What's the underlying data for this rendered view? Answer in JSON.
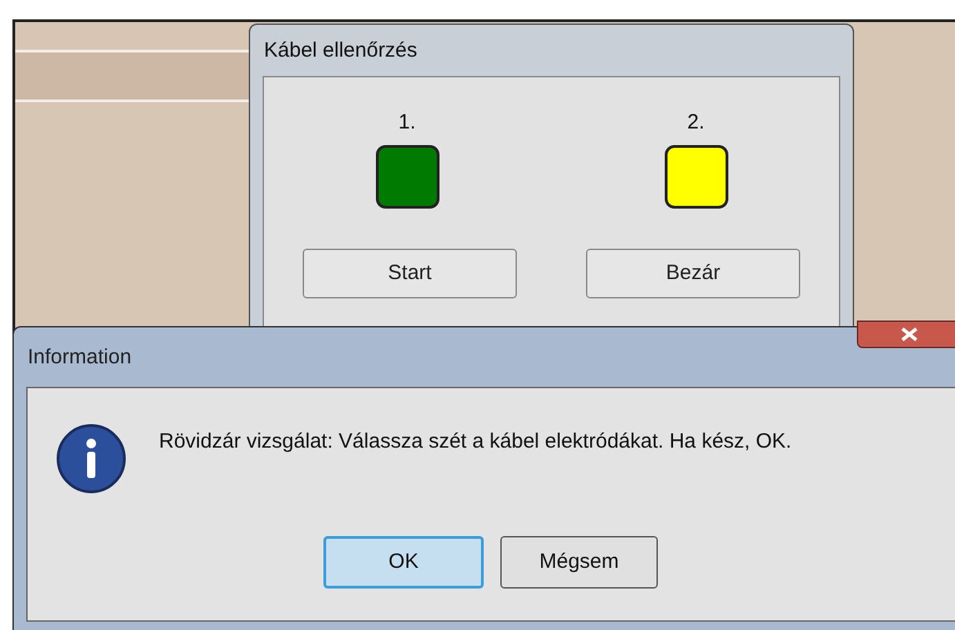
{
  "cable_dialog": {
    "title": "Kábel ellenőrzés",
    "indicators": [
      {
        "label": "1.",
        "color": "#007a00"
      },
      {
        "label": "2.",
        "color": "#ffff00"
      }
    ],
    "buttons": [
      "Start",
      "Bezár"
    ]
  },
  "message_box": {
    "title": "Information",
    "message": "Rövidzár vizsgálat: Válassza szét a kábel elektródákat. Ha kész, OK.",
    "buttons": [
      {
        "label": "OK",
        "focused": true
      },
      {
        "label": "Mégsem",
        "focused": false
      }
    ]
  }
}
